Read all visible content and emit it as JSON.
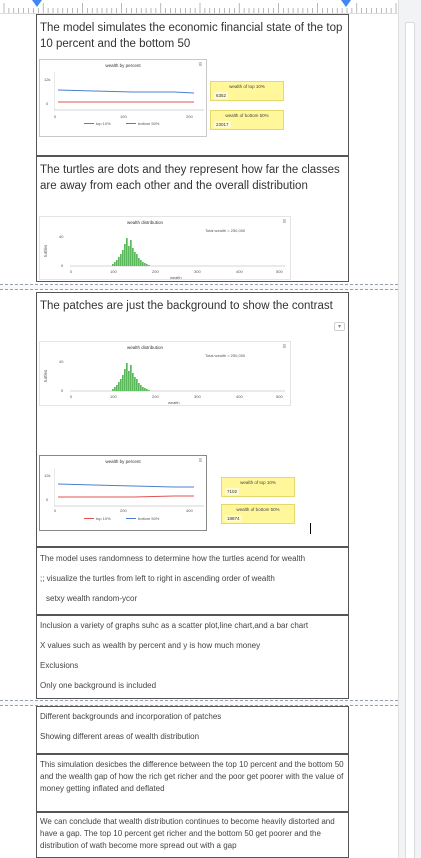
{
  "cells": {
    "c1_title": "The model simulates the economic financial state of the top 10 percent and the bottom 50",
    "c2_title": "The turtles are dots and they represent how far the classes are away from each other and the overall distribution",
    "c3_title": "The patches are just the background to show the contrast",
    "c4_lines": [
      "The model uses randomness to determine how the turtles acend for wealth",
      ";; visualize the turtles from left to right in ascending order of wealth",
      "setxy wealth random-ycor"
    ],
    "c5_lines": [
      "Inclusion a variety of graphs suhc as a scatter plot,line chart,and a bar chart",
      "X values such as wealth by percent and y is how much money",
      "Exclusions",
      "Only one background is included"
    ],
    "c6_lines": [
      "Different backgrounds and incorporation of patches",
      "Showing different areas of wealth distribution"
    ],
    "c7_text": "This simulation desicbes the difference between the top 10 percent and the bottom 50 and the wealth gap of how the rich get richer and the poor get poorer with the value of money getting inflated and deflated",
    "c8_text": "We can conclude that wealth distribution continues to become heavily distorted and have a gap. The top 10 percent get richer and the bottom 50 get poorer and the distribution of wath become more spread out with a gap"
  },
  "plot_pct_1": {
    "title": "wealth by percent",
    "y_ticks": [
      "12k",
      "0"
    ],
    "x_ticks": [
      "0",
      "100",
      "200"
    ],
    "legend": [
      "top 10%",
      "bottom 50%"
    ],
    "colors": {
      "top": "#e05252",
      "bottom": "#4a7fd1"
    }
  },
  "plot_pct_2": {
    "title": "wealth by percent",
    "y_ticks": [
      "12k",
      "0"
    ],
    "x_ticks": [
      "0",
      "200",
      "400"
    ],
    "legend": [
      "top 10%",
      "bottom 50%"
    ]
  },
  "monitors_1": [
    {
      "label": "wealth of top 10%",
      "value": "6352"
    },
    {
      "label": "wealth of bottom 50%",
      "value": "23017"
    }
  ],
  "monitors_2": [
    {
      "label": "wealth of top 10%",
      "value": "7102"
    },
    {
      "label": "wealth of bottom 50%",
      "value": "18874"
    }
  ],
  "dist_1": {
    "title": "wealth distribution",
    "annotation": "Total wealth = 250,000",
    "y_label": "turtles",
    "y_ticks": [
      "40",
      "0"
    ],
    "x_ticks": [
      "0",
      "100",
      "200",
      "300",
      "400",
      "500"
    ],
    "x_label": "wealth",
    "bar_color": "#5cb85c"
  },
  "dist_2": {
    "title": "wealth distribution",
    "annotation": "Total wealth = 250,000",
    "y_label": "turtles",
    "y_ticks": [
      "40",
      "0"
    ],
    "x_ticks": [
      "0",
      "100",
      "200",
      "300",
      "400",
      "500"
    ],
    "x_label": "wealth"
  },
  "icons": {
    "menu": "hamburger-icon",
    "comment": "comment-icon"
  },
  "menu_glyph": "≡",
  "comment_glyph": "▾"
}
